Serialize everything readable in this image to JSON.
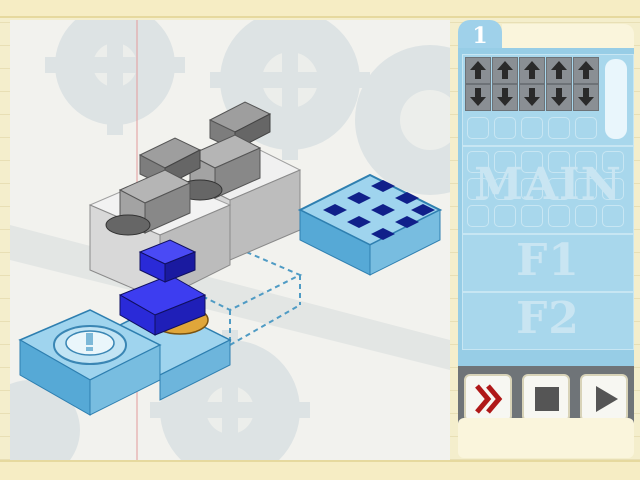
{
  "level": {
    "number": "1"
  },
  "panels": {
    "main_label": "MAIN",
    "f1_label": "F1",
    "f2_label": "F2"
  },
  "commands": [
    {
      "icon": "arrow-up-icon"
    },
    {
      "icon": "arrow-up-icon"
    },
    {
      "icon": "arrow-up-icon"
    },
    {
      "icon": "arrow-up-icon"
    },
    {
      "icon": "arrow-up-icon"
    },
    {
      "icon": "arrow-down-icon"
    },
    {
      "icon": "arrow-down-icon"
    },
    {
      "icon": "arrow-down-icon"
    },
    {
      "icon": "arrow-down-icon"
    },
    {
      "icon": "arrow-down-icon"
    }
  ],
  "controls": [
    {
      "name": "fast-forward-button",
      "icon": "double-chevron-icon"
    },
    {
      "name": "stop-button",
      "icon": "stop-square-icon"
    },
    {
      "name": "play-button",
      "icon": "play-triangle-icon"
    }
  ],
  "colors": {
    "panel": "#97cde6",
    "tile_blue": "#7cc4e4",
    "robot_blue": "#2a2ad8",
    "tread_orange": "#e0a63a",
    "goal_navy": "#10208a",
    "ffwd_red": "#b01818"
  }
}
